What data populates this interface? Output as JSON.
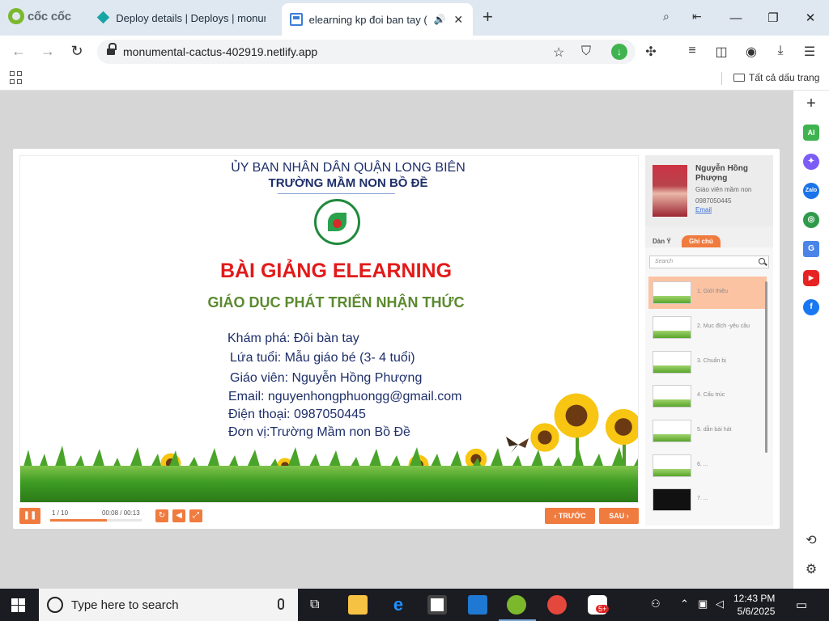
{
  "browser": {
    "brand": "cốc cốc",
    "tabs": [
      {
        "title": "Deploy details | Deploys | monum"
      },
      {
        "title": "elearning kp đoi ban tay (đ"
      }
    ],
    "url": "monumental-cactus-402919.netlify.app",
    "bookmarks_folder": "Tất cả dấu trang"
  },
  "slide": {
    "header_line1": "ỦY BAN NHÂN DÂN QUẬN LONG BIÊN",
    "header_line2": "TRƯỜNG MẦM NON BỒ ĐỀ",
    "title": "BÀI GIẢNG ELEARNING",
    "subtitle": "GIÁO DỤC PHÁT TRIỂN NHẬN THỨC",
    "info": [
      "Khám phá: Đôi bàn tay",
      "Lứa tuổi: Mẫu giáo bé (3- 4 tuổi)",
      "Giáo viên: Nguyễn Hồng Phượng",
      "Email: nguyenhongphuongg@gmail.com",
      "Điện thoại: 0987050445",
      "Đơn vị:Trường Mầm non Bồ Đề"
    ]
  },
  "player": {
    "slide_count": "1 / 10",
    "time": "00:08 / 00:13",
    "progress": 0.62,
    "prev_label": "TRƯỚC",
    "next_label": "SAU"
  },
  "presenter": {
    "name": "Nguyễn Hồng Phượng",
    "role": "Giáo viên mầm non",
    "phone": "0987050445",
    "email_link": "Email"
  },
  "sidebar": {
    "tab_outline": "Dàn Ý",
    "tab_notes": "Ghi chú",
    "search_placeholder": "Search",
    "items": [
      {
        "label": "1. Giới thiệu"
      },
      {
        "label": "2. Mục đích -yêu cầu"
      },
      {
        "label": "3. Chuẩn bị"
      },
      {
        "label": "4. Cấu trúc"
      },
      {
        "label": "5. dẫn bài hát"
      },
      {
        "label": "6. ..."
      },
      {
        "label": "7. ..."
      }
    ]
  },
  "taskbar": {
    "search_placeholder": "Type here to search",
    "time": "12:43 PM",
    "date": "5/6/2025",
    "badge": "5+"
  }
}
